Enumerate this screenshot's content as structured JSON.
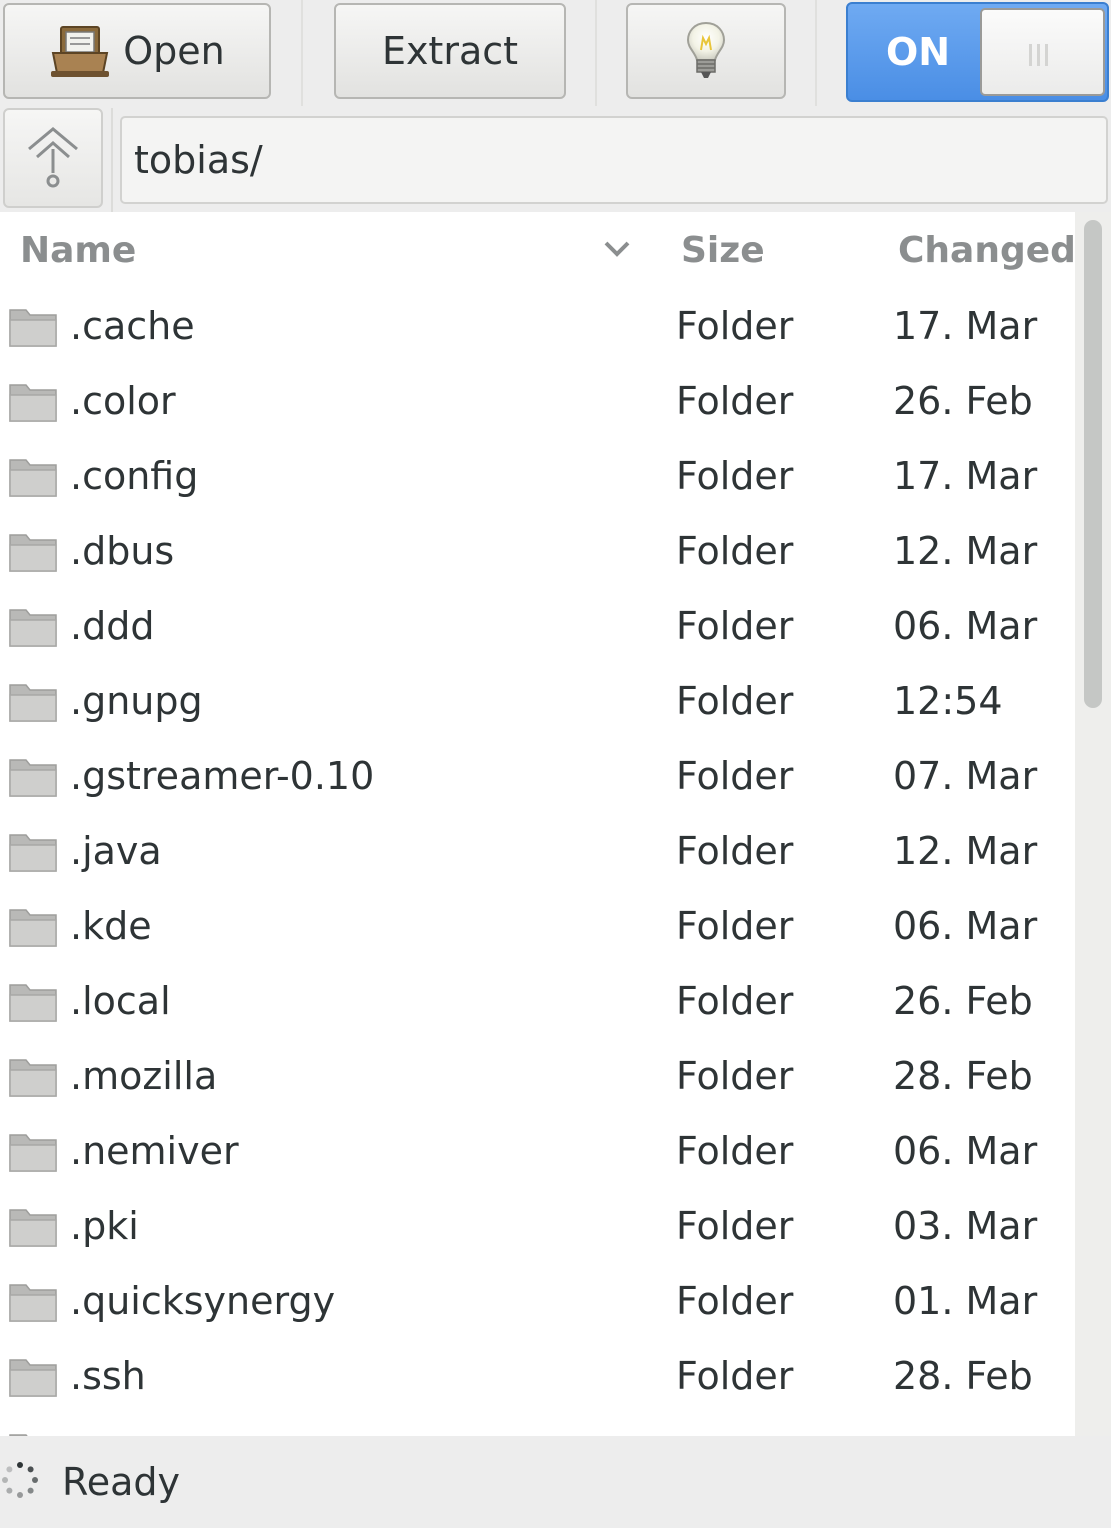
{
  "toolbar": {
    "open_label": "Open",
    "extract_label": "Extract",
    "hint_icon": "lightbulb-icon",
    "switch_label": "ON"
  },
  "location": {
    "path": "tobias/"
  },
  "columns": {
    "name": "Name",
    "size": "Size",
    "changed": "Changed"
  },
  "files": [
    {
      "name": ".cache",
      "size": "Folder",
      "changed": "17. Mar"
    },
    {
      "name": ".color",
      "size": "Folder",
      "changed": "26. Feb"
    },
    {
      "name": ".config",
      "size": "Folder",
      "changed": "17. Mar"
    },
    {
      "name": ".dbus",
      "size": "Folder",
      "changed": "12. Mar"
    },
    {
      "name": ".ddd",
      "size": "Folder",
      "changed": "06. Mar"
    },
    {
      "name": ".gnupg",
      "size": "Folder",
      "changed": "12:54"
    },
    {
      "name": ".gstreamer-0.10",
      "size": "Folder",
      "changed": "07. Mar"
    },
    {
      "name": ".java",
      "size": "Folder",
      "changed": "12. Mar"
    },
    {
      "name": ".kde",
      "size": "Folder",
      "changed": "06. Mar"
    },
    {
      "name": ".local",
      "size": "Folder",
      "changed": "26. Feb"
    },
    {
      "name": ".mozilla",
      "size": "Folder",
      "changed": "28. Feb"
    },
    {
      "name": ".nemiver",
      "size": "Folder",
      "changed": "06. Mar"
    },
    {
      "name": ".pki",
      "size": "Folder",
      "changed": "03. Mar"
    },
    {
      "name": ".quicksynergy",
      "size": "Folder",
      "changed": "01. Mar"
    },
    {
      "name": ".ssh",
      "size": "Folder",
      "changed": "28. Feb"
    },
    {
      "name": "",
      "size": "",
      "changed": ""
    }
  ],
  "status": {
    "text": "Ready"
  },
  "colors": {
    "accent": "#4a8ee5",
    "header_text": "#8b8e8f",
    "folder_icon": "#b9b9b7"
  }
}
